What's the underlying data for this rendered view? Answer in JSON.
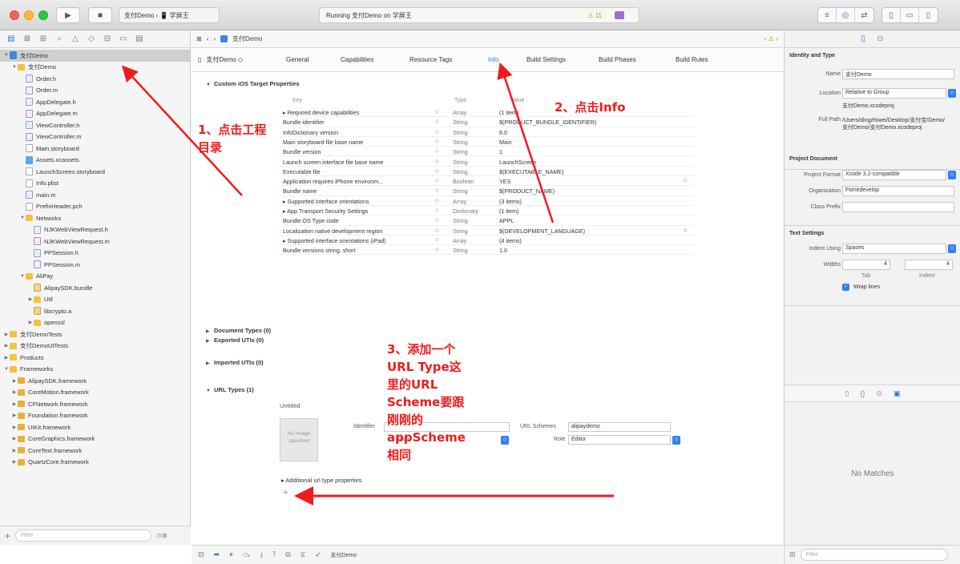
{
  "toolbar": {
    "scheme": "支付Demo › 📱 学屏王",
    "activity_status": "Running 支付Demo on 学屏王",
    "warning": "⚠ 11",
    "run_icon": "play-icon",
    "stop_icon": "stop-icon"
  },
  "navigator": {
    "tree": [
      {
        "label": "支付Demo",
        "icon": "proj",
        "level": 0,
        "disc": "▼",
        "selected": true
      },
      {
        "label": "支付Demo",
        "icon": "folder",
        "level": 1,
        "disc": "▼"
      },
      {
        "label": "Order.h",
        "icon": "hfile",
        "level": 2
      },
      {
        "label": "Order.m",
        "icon": "mfile",
        "level": 2
      },
      {
        "label": "AppDelegate.h",
        "icon": "hfile",
        "level": 2
      },
      {
        "label": "AppDelegate.m",
        "icon": "mfile",
        "level": 2
      },
      {
        "label": "ViewController.h",
        "icon": "hfile",
        "level": 2
      },
      {
        "label": "ViewController.m",
        "icon": "mfile",
        "level": 2
      },
      {
        "label": "Main.storyboard",
        "icon": "file",
        "level": 2
      },
      {
        "label": "Assets.xcassets",
        "icon": "asset",
        "level": 2
      },
      {
        "label": "LaunchScreen.storyboard",
        "icon": "file",
        "level": 2
      },
      {
        "label": "Info.plist",
        "icon": "file",
        "level": 2
      },
      {
        "label": "main.m",
        "icon": "mfile",
        "level": 2
      },
      {
        "label": "PrefixHeader.pch",
        "icon": "file",
        "level": 2
      },
      {
        "label": "Networks",
        "icon": "folder",
        "level": 2,
        "disc": "▼"
      },
      {
        "label": "NJKWebViewRequest.h",
        "icon": "hfile",
        "level": 3
      },
      {
        "label": "NJKWebViewRequest.m",
        "icon": "mfile",
        "level": 3
      },
      {
        "label": "PPSession.h",
        "icon": "hfile",
        "level": 3
      },
      {
        "label": "PPSession.m",
        "icon": "mfile",
        "level": 3
      },
      {
        "label": "AliPay",
        "icon": "folder",
        "level": 2,
        "disc": "▼"
      },
      {
        "label": "AlipaySDK.bundle",
        "icon": "img",
        "level": 3
      },
      {
        "label": "Util",
        "icon": "folder",
        "level": 3,
        "disc": "▶"
      },
      {
        "label": "libcrypto.a",
        "icon": "img",
        "level": 3
      },
      {
        "label": "openssl",
        "icon": "folder",
        "level": 3,
        "disc": "▶"
      },
      {
        "label": "支付DemoTests",
        "icon": "folder",
        "level": 0,
        "disc": "▶"
      },
      {
        "label": "支付DemoUITests",
        "icon": "folder",
        "level": 0,
        "disc": "▶"
      },
      {
        "label": "Products",
        "icon": "folder",
        "level": 0,
        "disc": "▶"
      },
      {
        "label": "Frameworks",
        "icon": "folder",
        "level": 0,
        "disc": "▼"
      },
      {
        "label": "AlipaySDK.framework",
        "icon": "fw",
        "level": 1,
        "disc": "▶"
      },
      {
        "label": "CoreMotion.framework",
        "icon": "fw",
        "level": 1,
        "disc": "▶"
      },
      {
        "label": "CFNetwork.framework",
        "icon": "fw",
        "level": 1,
        "disc": "▶"
      },
      {
        "label": "Foundation.framework",
        "icon": "fw",
        "level": 1,
        "disc": "▶"
      },
      {
        "label": "UIKit.framework",
        "icon": "fw",
        "level": 1,
        "disc": "▶"
      },
      {
        "label": "CoreGraphics.framework",
        "icon": "fw",
        "level": 1,
        "disc": "▶"
      },
      {
        "label": "CoreText.framework",
        "icon": "fw",
        "level": 1,
        "disc": "▶"
      },
      {
        "label": "QuartzCore.framework",
        "icon": "fw",
        "level": 1,
        "disc": "▶"
      }
    ],
    "filter_placeholder": "Filter"
  },
  "jumpbar": {
    "project": "支付Demo"
  },
  "tabs": {
    "target": "支付Demo ◇",
    "items": [
      "General",
      "Capabilities",
      "Resource Tags",
      "Info",
      "Build Settings",
      "Build Phases",
      "Build Rules"
    ],
    "active": "Info"
  },
  "info": {
    "section_custom": "Custom iOS Target Properties",
    "col_key": "Key",
    "col_type": "Type",
    "col_value": "Value",
    "rows": [
      {
        "k": "▸ Required device capabilities",
        "t": "Array",
        "v": "(1 item)"
      },
      {
        "k": "Bundle identifier",
        "t": "String",
        "v": "$(PRODUCT_BUNDLE_IDENTIFIER)"
      },
      {
        "k": "InfoDictionary version",
        "t": "String",
        "v": "6.0"
      },
      {
        "k": "Main storyboard file base name",
        "t": "String",
        "v": "Main"
      },
      {
        "k": "Bundle version",
        "t": "String",
        "v": "1"
      },
      {
        "k": "Launch screen interface file base name",
        "t": "String",
        "v": "LaunchScreen"
      },
      {
        "k": "Executable file",
        "t": "String",
        "v": "$(EXECUTABLE_NAME)"
      },
      {
        "k": "Application requires iPhone environm...",
        "t": "Boolean",
        "v": "YES",
        "pop": "◇"
      },
      {
        "k": "Bundle name",
        "t": "String",
        "v": "$(PRODUCT_NAME)"
      },
      {
        "k": "▸ Supported interface orientations",
        "t": "Array",
        "v": "(3 items)"
      },
      {
        "k": "▸ App Transport Security Settings",
        "t": "Dictionary",
        "v": "(1 item)"
      },
      {
        "k": "Bundle OS Type code",
        "t": "String",
        "v": "APPL"
      },
      {
        "k": "Localization native development region",
        "t": "String",
        "v": "$(DEVELOPMENT_LANGUAGE)",
        "pop": "◇"
      },
      {
        "k": "▸ Supported interface orientations (iPad)",
        "t": "Array",
        "v": "(4 items)"
      },
      {
        "k": "Bundle versions string, short",
        "t": "String",
        "v": "1.0"
      }
    ],
    "section_doc": "Document Types (0)",
    "section_exported": "Exported UTIs (0)",
    "section_imported": "Imported UTIs (0)",
    "section_url": "URL Types (1)",
    "url_title": "Untitled",
    "no_image": "No Image specified",
    "identifier_label": "Identifier",
    "identifier_value": "",
    "icon_label": "Icon",
    "url_schemes_label": "URL Schemes",
    "url_schemes_value": "alipaydemo",
    "role_label": "Role",
    "role_value": "Editor",
    "additional": "▸ Additional url type properties",
    "add_plus": "+"
  },
  "debugbar": {
    "scheme": "支付Demo"
  },
  "inspector": {
    "identity_title": "Identity and Type",
    "name_label": "Name",
    "name_value": "支付Demo",
    "location_label": "Location",
    "location_value": "Relative to Group",
    "location_file": "支付Demo.xcodeproj",
    "fullpath_label": "Full Path",
    "fullpath_value": "/Users/dingzhiwei/Desktop/支付宝/Demo/支付Demo/支付Demo.xcodeproj",
    "project_doc_title": "Project Document",
    "format_label": "Project Format",
    "format_value": "Xcode 3.2-compatible",
    "org_label": "Organization",
    "org_value": "Ftimedevelop",
    "class_label": "Class Prefix",
    "class_value": "",
    "text_title": "Text Settings",
    "indent_label": "Indent Using",
    "indent_value": "Spaces",
    "widths_label": "Widths",
    "tab_value": "4",
    "indent_value2": "4",
    "tab_caption": "Tab",
    "indent_caption": "Indent",
    "wrap_label": "Wrap lines",
    "no_matches": "No Matches",
    "filter_placeholder": "Filter"
  },
  "annotations": {
    "step1": "1、点击工程目录",
    "step2": "2、点击Info",
    "step3": "3、添加一个URL Type这里的URL Scheme要跟刚刚的appScheme相同"
  },
  "colors": {
    "annotation": "#ee1c1c",
    "accent": "#2b75d8"
  }
}
